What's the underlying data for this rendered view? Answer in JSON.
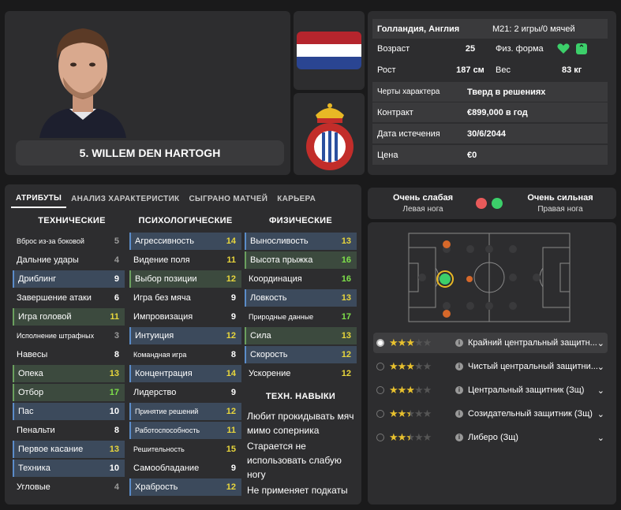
{
  "player": {
    "name": "5. WILLEM DEN HARTOGH"
  },
  "info": {
    "nationality": "Голландия, Англия",
    "u21": "M21: 2 игры/0 мячей",
    "age_label": "Возраст",
    "age": "25",
    "fitness_label": "Физ. форма",
    "height_label": "Рост",
    "height": "187 см",
    "weight_label": "Вес",
    "weight": "83 кг",
    "traits_label": "Черты характера",
    "traits": "Тверд в решениях",
    "contract_label": "Контракт",
    "contract": "€899,000 в год",
    "expiry_label": "Дата истечения",
    "expiry": "30/6/2044",
    "price_label": "Цена",
    "price": "€0"
  },
  "tabs": [
    "АТРИБУТЫ",
    "АНАЛИЗ ХАРАКТЕРИСТИК",
    "СЫГРАНО МАТЧЕЙ",
    "КАРЬЕРА"
  ],
  "headers": {
    "technical": "ТЕХНИЧЕСКИЕ",
    "mental": "ПСИХОЛОГИЧЕСКИЕ",
    "physical": "ФИЗИЧЕСКИЕ",
    "skills": "ТЕХН. НАВЫКИ"
  },
  "technical": [
    {
      "label": "Вброс из-за боковой",
      "value": "5"
    },
    {
      "label": "Дальние удары",
      "value": "4"
    },
    {
      "label": "Дриблинг",
      "value": "9"
    },
    {
      "label": "Завершение атаки",
      "value": "6"
    },
    {
      "label": "Игра головой",
      "value": "11"
    },
    {
      "label": "Исполнение штрафных",
      "value": "3"
    },
    {
      "label": "Навесы",
      "value": "8"
    },
    {
      "label": "Опека",
      "value": "13"
    },
    {
      "label": "Отбор",
      "value": "17"
    },
    {
      "label": "Пас",
      "value": "10"
    },
    {
      "label": "Пенальти",
      "value": "8"
    },
    {
      "label": "Первое касание",
      "value": "13"
    },
    {
      "label": "Техника",
      "value": "10"
    },
    {
      "label": "Угловые",
      "value": "4"
    }
  ],
  "mental": [
    {
      "label": "Агрессивность",
      "value": "14"
    },
    {
      "label": "Видение поля",
      "value": "11"
    },
    {
      "label": "Выбор позиции",
      "value": "12"
    },
    {
      "label": "Игра без мяча",
      "value": "9"
    },
    {
      "label": "Импровизация",
      "value": "9"
    },
    {
      "label": "Интуиция",
      "value": "12"
    },
    {
      "label": "Командная игра",
      "value": "8"
    },
    {
      "label": "Концентрация",
      "value": "14"
    },
    {
      "label": "Лидерство",
      "value": "9"
    },
    {
      "label": "Принятие решений",
      "value": "12"
    },
    {
      "label": "Работоспособность",
      "value": "11"
    },
    {
      "label": "Решительность",
      "value": "15"
    },
    {
      "label": "Самообладание",
      "value": "9"
    },
    {
      "label": "Храбрость",
      "value": "12"
    }
  ],
  "physical": [
    {
      "label": "Выносливость",
      "value": "13"
    },
    {
      "label": "Высота прыжка",
      "value": "16"
    },
    {
      "label": "Координация",
      "value": "16"
    },
    {
      "label": "Ловкость",
      "value": "13"
    },
    {
      "label": "Природные данные",
      "value": "17"
    },
    {
      "label": "Сила",
      "value": "13"
    },
    {
      "label": "Скорость",
      "value": "12"
    },
    {
      "label": "Ускорение",
      "value": "12"
    }
  ],
  "skills": [
    "Любит прокидывать мяч мимо соперника",
    "Старается не использовать слабую ногу",
    "Не применяет подкаты"
  ],
  "foot": {
    "left_rating": "Очень слабая",
    "left_label": "Левая нога",
    "right_rating": "Очень сильная",
    "right_label": "Правая нога",
    "left_color": "#e85a5a",
    "right_color": "#3ccf6a"
  },
  "roles": [
    {
      "label": "Крайний центральный защитн...",
      "stars": 3
    },
    {
      "label": "Чистый центральный защитни...",
      "stars": 3
    },
    {
      "label": "Центральный защитник (Зщ)",
      "stars": 3
    },
    {
      "label": "Созидательный защитник (Зщ)",
      "stars": 2.5
    },
    {
      "label": "Либеро (Зщ)",
      "stars": 2.5
    }
  ]
}
